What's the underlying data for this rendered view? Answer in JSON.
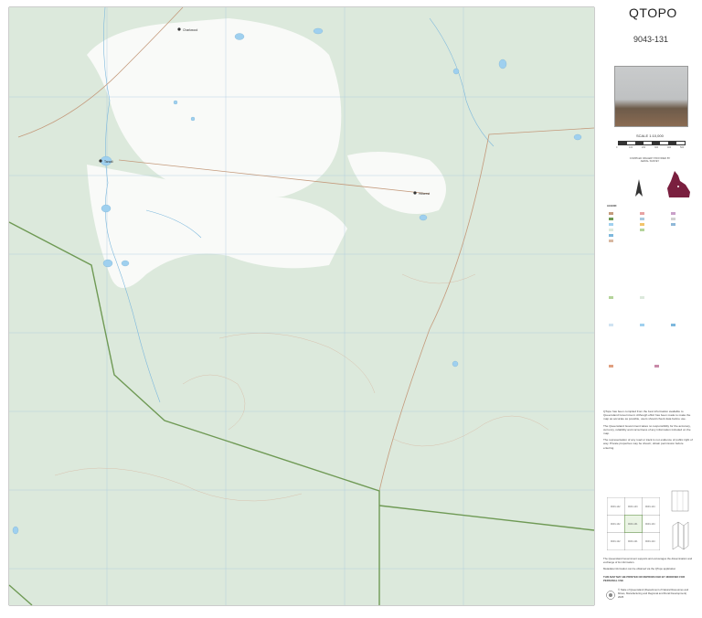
{
  "title": "QTOPO",
  "sheet_number": "9043-131",
  "scale": "SCALE 1:10,000",
  "scale_ticks": [
    "0",
    "100",
    "200",
    "300",
    "400",
    "500"
  ],
  "info_block": "COMPILED IMAGERY PROVIDED BY AERIAL SURVEY",
  "legend_heading": "LEGEND",
  "body_paragraphs": [
    "QTopo has been compiled from the best information available to Queensland Government. Although effort has been made to make the map as accurate as possible, users should check data before use.",
    "The Queensland Government takes no responsibility for the accuracy, currency, reliability and correctness of any information included on the map.",
    "The representation of any road or track is not evidence of public right of way. Private properties may be shown; obtain permission before entering."
  ],
  "footer_note": "The Queensland Government supports and encourages the dissemination and exchange of its information.",
  "footer_metadata": "Metadata information can be obtained via the QTopo application",
  "footer_warning": "THIS MAP MAY BE PRINTED OR REPRODUCED BY MODIFIED FOR PERSONAL USE",
  "copyright": "© State of Queensland (Department of Natural Resources and Mines, Manufacturing and Regional and Rural Development) 2025",
  "places": [
    {
      "name": "Charlwood"
    },
    {
      "name": "Tarzali"
    },
    {
      "name": "Hillcrest"
    }
  ],
  "index_sheets": [
    "9043-142",
    "9043-143",
    "9043-144",
    "9043-132",
    "9043-131",
    "9043-134",
    "9043-122",
    "9043-121",
    "9043-124"
  ],
  "colors": {
    "map_bg": "#f6f8f5",
    "veg": "#dce9dc",
    "water": "#9fd0ef",
    "grid": "#a9c9de",
    "road": "#c49a7c",
    "boundary": "#6f9a55"
  }
}
